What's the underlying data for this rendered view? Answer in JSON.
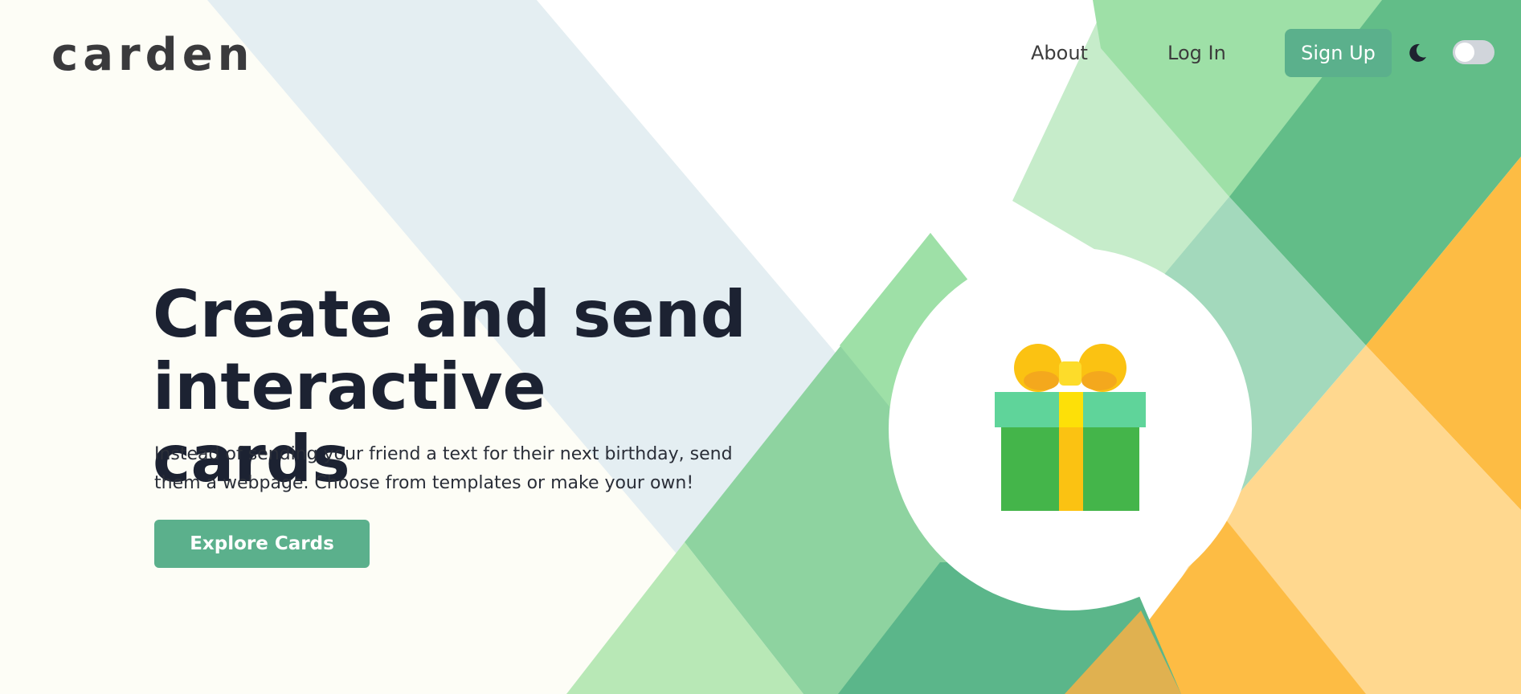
{
  "brand": {
    "logo_text": "carden"
  },
  "nav": {
    "items": [
      {
        "label": "About"
      },
      {
        "label": "Log In"
      }
    ],
    "signup_label": "Sign Up",
    "theme_icon": "moon-icon",
    "theme_toggle_on": false
  },
  "hero": {
    "title_line1": "Create and send",
    "title_line2": "interactive cards",
    "subtitle_line1": "Instead of sending your friend a text for their next birthday, send",
    "subtitle_line2": "them a webpage. Choose from templates or make your own!",
    "cta_label": "Explore Cards",
    "illustration_icon": "gift-icon"
  },
  "colors": {
    "accent": "#5bb08c",
    "title_text": "#1c2232",
    "background": "#fdfdf6",
    "gift_box": "#44b54a",
    "gift_lid": "#5fd49a",
    "gift_ribbon": "#fbc212",
    "orange_band": "#fdbc44"
  }
}
